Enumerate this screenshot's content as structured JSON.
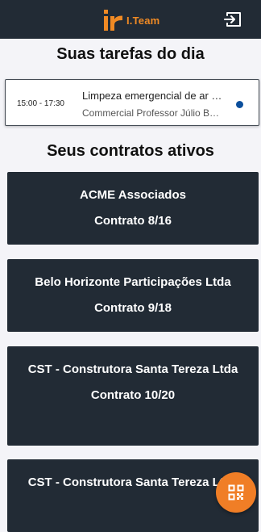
{
  "header": {
    "brand_name": "I.Team",
    "logo_icon": "ir-logo-icon",
    "logout_icon": "logout-icon",
    "accent_color": "#f08a24",
    "background_color": "#222b35"
  },
  "tasks_section": {
    "title": "Suas tarefas do dia",
    "tasks": [
      {
        "time": "15:00 - 17:30",
        "title": "Limpeza emergencial de ar condicionado",
        "subtitle": "Commercial Professor Júlio Bueno",
        "status_color": "#0b4f9c"
      }
    ]
  },
  "contracts_section": {
    "title": "Seus contratos ativos",
    "contracts": [
      {
        "name": "ACME Associados",
        "contract": "Contrato 8/16"
      },
      {
        "name": "Belo Horizonte Participações Ltda",
        "contract": "Contrato 9/18"
      },
      {
        "name": "CST - Construtora Santa Tereza Ltda",
        "contract": "Contrato 10/20"
      },
      {
        "name": "CST - Construtora Santa Tereza Ltda",
        "contract": ""
      }
    ]
  },
  "fab": {
    "icon": "qr-code-icon",
    "color": "#f07e26"
  }
}
